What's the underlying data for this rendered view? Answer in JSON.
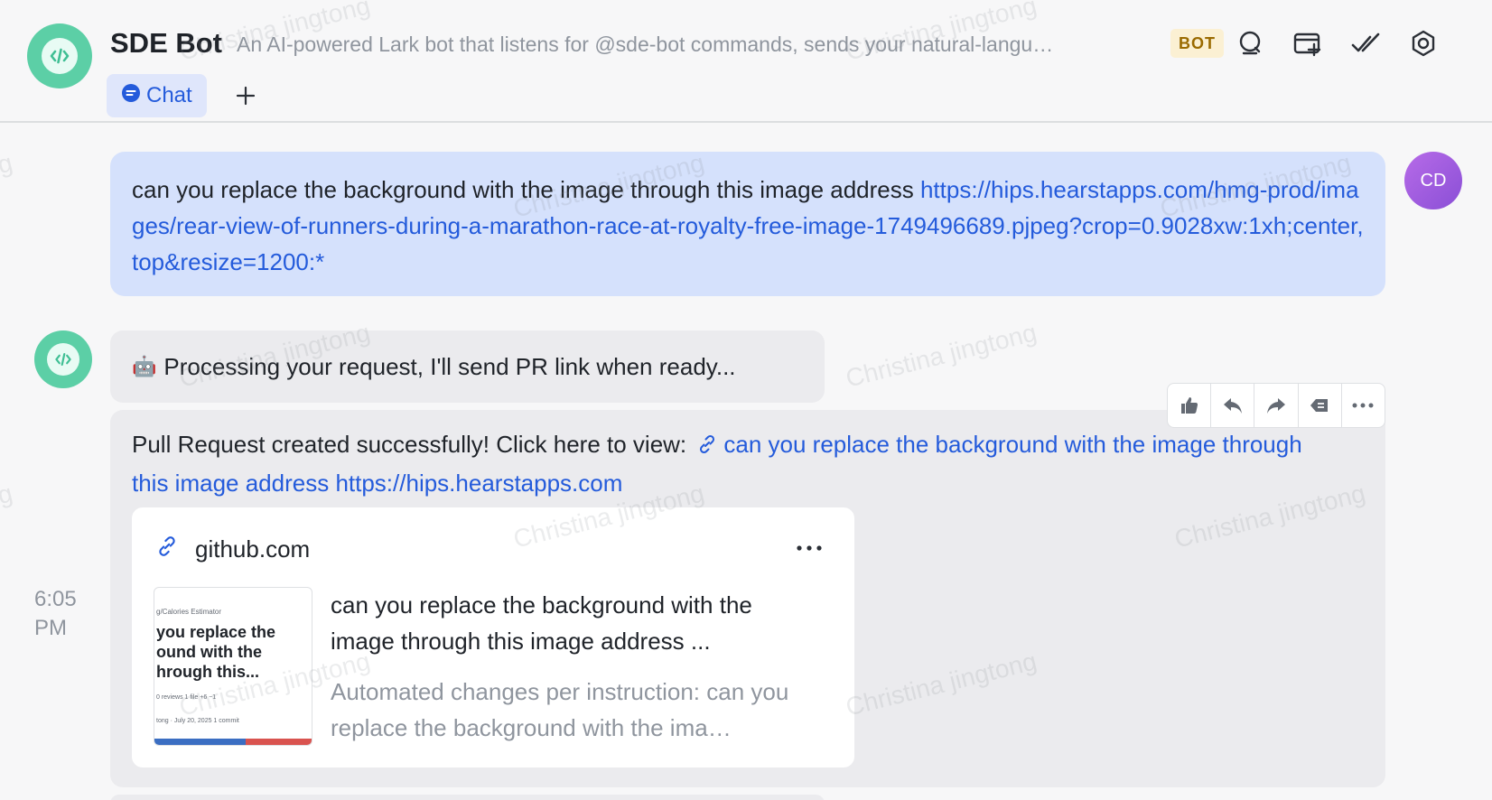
{
  "header": {
    "title": "SDE Bot",
    "description": "An AI-powered Lark bot that listens for @sde-bot commands, sends your natural-langu…",
    "badge": "BOT",
    "tabs": [
      {
        "label": "Chat",
        "icon": "chat-bubble-icon",
        "active": true
      }
    ],
    "add_tab_label": "+",
    "icons": [
      "search-icon",
      "add-window-icon",
      "check-all-icon",
      "settings-icon"
    ]
  },
  "messages": {
    "user": {
      "avatar_initials": "CD",
      "text": "can you replace the background with the image through this image address ",
      "link": "https://hips.hearstapps.com/hmg-prod/images/rear-view-of-runners-during-a-marathon-race-at-royalty-free-image-1749496689.pjpeg?crop=0.9028xw:1xh;center,top&resize=1200:*"
    },
    "bot_processing": {
      "emoji": "🤖",
      "text": "Processing your request, I'll send PR link when ready..."
    },
    "bot_result": {
      "text": "Pull Request created successfully! Click here to view:",
      "link_text": "can you replace the background with the image through this image address https://hips.hearstapps.com",
      "card": {
        "domain": "github.com",
        "title": "can you replace the background with the image through this image address ...",
        "description": "Automated changes per instruction: can you replace the background with the ima…",
        "thumbnail": {
          "breadcrumb": "g/Calories Estimator",
          "title": "you replace the ound with the hrough this...",
          "meta1": "0 reviews   1 file   +6 −1",
          "meta2": "tong · July 20, 2025   1 commit"
        }
      },
      "time": "6:05 PM"
    }
  },
  "toolbar": {
    "icons": [
      "thumbs-up-icon",
      "reply-icon",
      "forward-icon",
      "quote-icon",
      "more-icon"
    ]
  },
  "watermark": "Christina jingtong",
  "colors": {
    "accent": "#245bdb",
    "bot_avatar": "#5ccfa6",
    "user_bubble": "#d5e1fc",
    "bot_bubble": "#ebebee",
    "badge_bg": "#fbf0d3"
  }
}
